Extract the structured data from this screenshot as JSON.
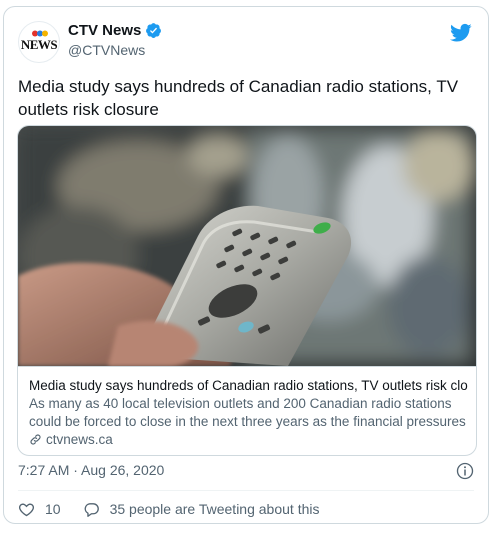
{
  "account": {
    "display_name": "CTV News",
    "handle": "@CTVNews",
    "avatar_text": "NEWS",
    "verified": true
  },
  "tweet": {
    "text": "Media study says hundreds of Canadian radio stations, TV outlets risk closure",
    "timestamp": "7:27 AM · Aug 26, 2020"
  },
  "card": {
    "title": "Media study says hundreds of Canadian radio stations, TV outlets risk clo...",
    "description_line1": "As many as 40 local television outlets and 200 Canadian radio stations",
    "description_line2": "could be forced to close in the next three years as the financial pressures ...",
    "domain": "ctvnews.ca",
    "image_icon": "tv-remote-photo"
  },
  "engagement": {
    "likes": "10",
    "conversation": "35 people are Tweeting about this"
  },
  "icons": {
    "bird": "twitter-bird-icon",
    "verified": "verified-badge-icon",
    "link": "link-icon",
    "info": "info-icon",
    "like": "heart-icon",
    "reply": "speech-bubble-icon"
  },
  "colors": {
    "twitter_blue": "#1d9bf0",
    "text_primary": "#0f1419",
    "text_secondary": "#536471",
    "border": "#cfd9de"
  }
}
